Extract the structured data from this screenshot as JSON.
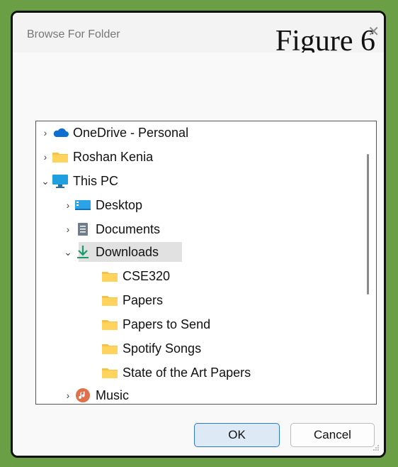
{
  "dialog": {
    "title": "Browse For Folder",
    "figure_label": "Figure 6",
    "close_glyph": "✕"
  },
  "tree": {
    "items": [
      {
        "label": "OneDrive - Personal",
        "icon": "cloud-icon",
        "expanded": false
      },
      {
        "label": "Roshan Kenia",
        "icon": "folder-icon",
        "expanded": false
      },
      {
        "label": "This PC",
        "icon": "monitor-icon",
        "expanded": true
      },
      {
        "label": "Desktop",
        "icon": "desktop-folder-icon",
        "expanded": false
      },
      {
        "label": "Documents",
        "icon": "document-icon",
        "expanded": false
      },
      {
        "label": "Downloads",
        "icon": "download-icon",
        "expanded": true,
        "selected": true
      },
      {
        "label": "CSE320",
        "icon": "folder-icon"
      },
      {
        "label": "Papers",
        "icon": "folder-icon"
      },
      {
        "label": "Papers to Send",
        "icon": "folder-icon"
      },
      {
        "label": "Spotify Songs",
        "icon": "folder-icon"
      },
      {
        "label": "State of the Art Papers",
        "icon": "folder-icon"
      },
      {
        "label": "Music",
        "icon": "music-icon",
        "expanded": false
      }
    ]
  },
  "buttons": {
    "ok": "OK",
    "cancel": "Cancel"
  },
  "colors": {
    "border_green": "#6a9f45",
    "ok_accent": "#2b79c8",
    "folder_yellow": "#f7c244",
    "download_green": "#1a9a6a"
  }
}
